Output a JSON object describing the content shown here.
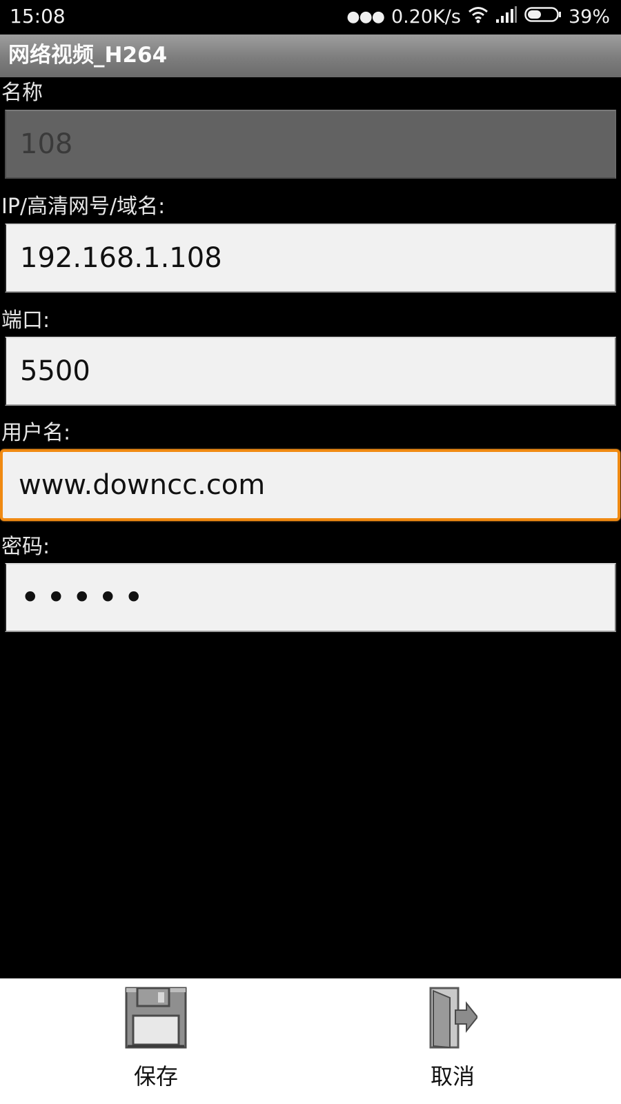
{
  "status_bar": {
    "time": "15:08",
    "network_speed": "0.20K/s",
    "battery": "39%",
    "icons": [
      "more-dots-icon",
      "wifi-icon",
      "signal-icon",
      "battery-icon"
    ]
  },
  "title_bar": {
    "title": "网络视频_H264"
  },
  "form": {
    "name": {
      "label": "名称",
      "value": "108"
    },
    "host": {
      "label": "IP/高清网号/域名:",
      "value": "192.168.1.108"
    },
    "port": {
      "label": "端口:",
      "value": "5500"
    },
    "username": {
      "label": "用户名:",
      "value": "www.downcc.com"
    },
    "password": {
      "label": "密码:",
      "value": "•••••"
    }
  },
  "bottom_bar": {
    "save_label": "保存",
    "save_icon": "floppy-disk-icon",
    "cancel_label": "取消",
    "cancel_icon": "exit-door-icon"
  },
  "colors": {
    "background": "#000000",
    "title_gradient_top": "#9e9e9e",
    "field_background": "#f1f1f1",
    "disabled_field": "#626262",
    "focus_border": "#f08a12",
    "bottom_bar": "#ffffff"
  }
}
